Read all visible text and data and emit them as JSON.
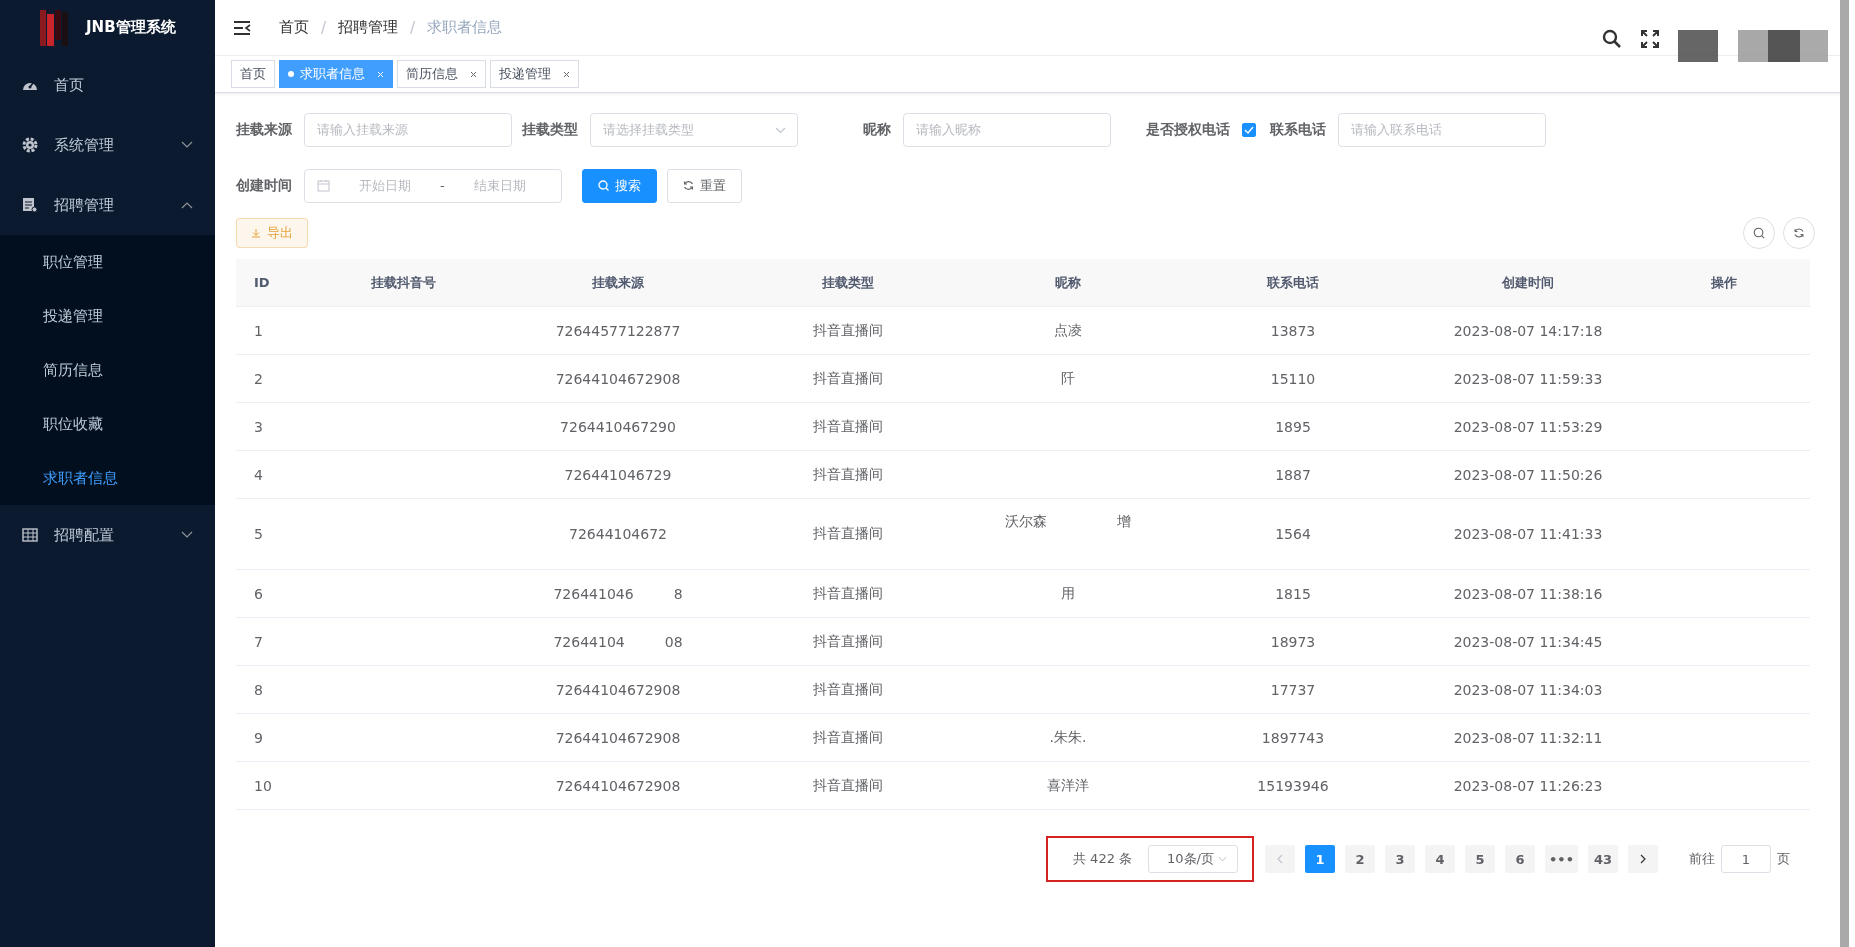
{
  "sidebar": {
    "logo_text": "JNB管理系统",
    "items": [
      {
        "label": "首页",
        "selected": false
      },
      {
        "label": "系统管理",
        "selected": false,
        "expanded": false
      },
      {
        "label": "招聘管理",
        "selected": false,
        "expanded": true,
        "children": [
          {
            "label": "职位管理",
            "selected": false
          },
          {
            "label": "投递管理",
            "selected": false
          },
          {
            "label": "简历信息",
            "selected": false
          },
          {
            "label": "职位收藏",
            "selected": false
          },
          {
            "label": "求职者信息",
            "selected": true
          }
        ]
      },
      {
        "label": "招聘配置",
        "selected": false,
        "expanded": false
      }
    ]
  },
  "breadcrumb": [
    {
      "label": "首页",
      "current": false
    },
    {
      "separator": "/",
      "label": "招聘管理",
      "current": false
    },
    {
      "separator": "/",
      "label": "求职者信息",
      "current": true
    }
  ],
  "tabs": [
    {
      "label": "首页",
      "selected": false,
      "closable": false
    },
    {
      "label": "求职者信息",
      "selected": true,
      "closable": true
    },
    {
      "label": "简历信息",
      "selected": false,
      "closable": true
    },
    {
      "label": "投递管理",
      "selected": false,
      "closable": true
    }
  ],
  "filters": [
    [
      {
        "kind": "input",
        "label": "挂载来源",
        "placeholder": "请输入挂载来源"
      },
      {
        "kind": "select",
        "label": "挂载类型",
        "placeholder": "请选择挂载类型"
      },
      {
        "kind": "input",
        "label": "昵称",
        "placeholder": "请输入昵称"
      },
      {
        "kind": "checkbox",
        "label": "是否授权电话",
        "checked": true
      },
      {
        "kind": "input",
        "label": "联系电话",
        "placeholder": "请输入联系电话"
      }
    ],
    [
      {
        "kind": "daterange",
        "label": "创建时间",
        "start_placeholder": "开始日期",
        "separator": "-",
        "end_placeholder": "结束日期"
      },
      {
        "kind": "button",
        "label": "搜索",
        "primary": true
      },
      {
        "kind": "button",
        "label": "重置",
        "primary": false
      }
    ]
  ],
  "export_button": "导出",
  "table": {
    "columns": [
      "ID",
      "挂载抖音号",
      "挂载来源",
      "挂载类型",
      "昵称",
      "联系电话",
      "创建时间",
      "操作"
    ],
    "rows": [
      {
        "id": "1",
        "source": [
          "72644577122877"
        ],
        "type": "抖音直播间",
        "nickname": [
          "点凌"
        ],
        "phone": "13873",
        "created": "2023-08-07 14:17:18"
      },
      {
        "id": "2",
        "source": [
          "72644104672908"
        ],
        "type": "抖音直播间",
        "nickname": [
          "阡"
        ],
        "phone": "15110",
        "created": "2023-08-07 11:59:33"
      },
      {
        "id": "3",
        "source": [
          "7264410467290"
        ],
        "type": "抖音直播间",
        "phone": "1895",
        "created": "2023-08-07 11:53:29"
      },
      {
        "id": "4",
        "source": [
          "726441046729"
        ],
        "type": "抖音直播间",
        "phone": "1887",
        "created": "2023-08-07 11:50:26"
      },
      {
        "id": "5",
        "source": [
          "72644104672"
        ],
        "type": "抖音直播间",
        "nickname": [
          "沃尔森",
          "增"
        ],
        "phone": "1564",
        "created": "2023-08-07 11:41:33"
      },
      {
        "id": "6",
        "source": [
          "726441046",
          "8"
        ],
        "type": "抖音直播间",
        "nickname": [
          "用"
        ],
        "phone": "1815",
        "created": "2023-08-07 11:38:16"
      },
      {
        "id": "7",
        "source": [
          "72644104",
          "08"
        ],
        "type": "抖音直播间",
        "phone": "18973",
        "created": "2023-08-07 11:34:45"
      },
      {
        "id": "8",
        "source": [
          "72644104672908"
        ],
        "type": "抖音直播间",
        "phone": "17737",
        "created": "2023-08-07 11:34:03"
      },
      {
        "id": "9",
        "source": [
          "72644104672908"
        ],
        "type": "抖音直播间",
        "nickname": [
          ".朱朱."
        ],
        "phone": "1897743",
        "created": "2023-08-07 11:32:11"
      },
      {
        "id": "10",
        "source": [
          "72644104672908"
        ],
        "type": "抖音直播间",
        "nickname": [
          "喜洋洋"
        ],
        "phone": "15193946",
        "created": "2023-08-07 11:26:23"
      }
    ]
  },
  "pagination": {
    "total": "共 422 条",
    "page_size": "10条/页",
    "pages": [
      {
        "label": "1",
        "selected": true
      },
      {
        "label": "2",
        "selected": false
      },
      {
        "label": "3",
        "selected": false
      },
      {
        "label": "4",
        "selected": false
      },
      {
        "label": "5",
        "selected": false
      },
      {
        "label": "6",
        "selected": false
      },
      {
        "label": "•••",
        "selected": false
      },
      {
        "label": "43",
        "selected": false
      }
    ],
    "goto_label": "前往",
    "goto_value": "1",
    "goto_unit": "页"
  }
}
